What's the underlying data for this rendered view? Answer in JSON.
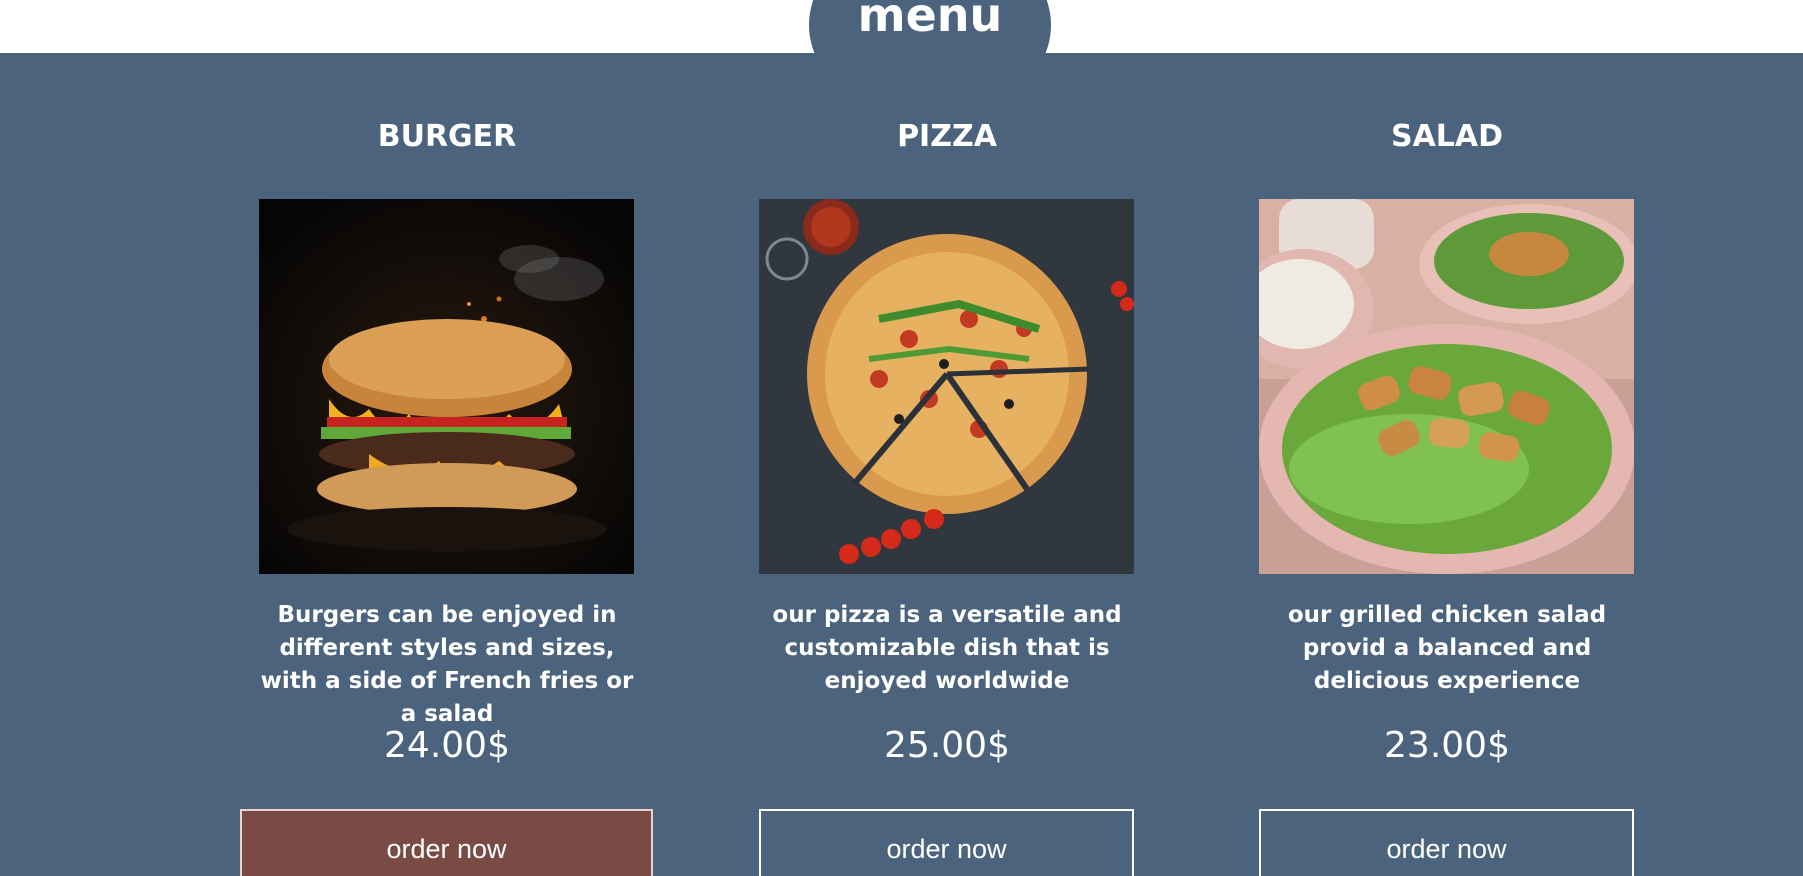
{
  "header": {
    "title": "menu"
  },
  "colors": {
    "section_bg": "#4c637d",
    "active_button": "#7a4b45",
    "text": "#ffffff"
  },
  "menu": {
    "items": [
      {
        "title": "BURGER",
        "image_icon": "burger-photo",
        "description": "Burgers can be enjoyed in different styles and sizes, with a side of French fries or a salad",
        "price": "24.00$",
        "button_label": "order now"
      },
      {
        "title": "PIZZA",
        "image_icon": "pizza-photo",
        "description": "our pizza is a versatile and customizable dish that is enjoyed worldwide",
        "price": "25.00$",
        "button_label": "order now"
      },
      {
        "title": "SALAD",
        "image_icon": "salad-photo",
        "description": "our grilled chicken salad provid a balanced and delicious experience",
        "price": "23.00$",
        "button_label": "order now"
      }
    ]
  }
}
